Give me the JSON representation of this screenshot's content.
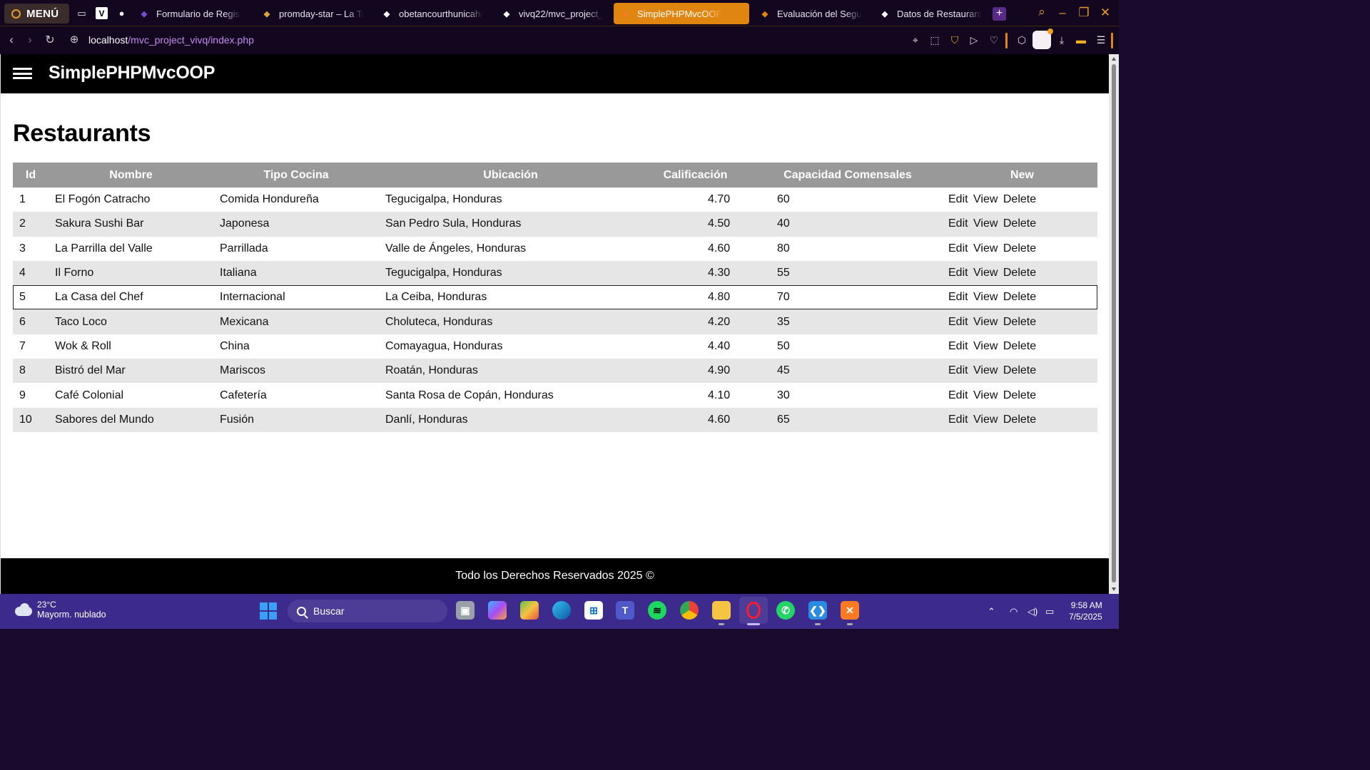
{
  "browser": {
    "menu_label": "MENÚ",
    "tabs": [
      {
        "label": "Formulario de Registro",
        "icon": "form-icon",
        "color": "#7a4bd1"
      },
      {
        "label": "promday-star – La Tarea",
        "icon": "page-icon",
        "color": "#d9a441"
      },
      {
        "label": "obetancourthunicah/",
        "icon": "github-icon",
        "color": "#ffffff"
      },
      {
        "label": "vivq22/mvc_project_",
        "icon": "github-icon",
        "color": "#ffffff"
      },
      {
        "label": "SimplePHPMvcOOP",
        "icon": "xampp-icon",
        "color": "#fb7a24"
      },
      {
        "label": "Evaluación del Seguimiento",
        "icon": "in-icon",
        "color": "#e08510"
      },
      {
        "label": "Datos de Restaurantes",
        "icon": "openai-icon",
        "color": "#ffffff"
      }
    ],
    "active_tab_index": 4,
    "url_host": "localhost",
    "url_path": "/mvc_project_vivq/index.php"
  },
  "site": {
    "title": "SimplePHPMvcOOP",
    "footer": "Todo los Derechos Reservados 2025 ©"
  },
  "page": {
    "heading": "Restaurants",
    "columns": {
      "id": "Id",
      "nombre": "Nombre",
      "tipo": "Tipo Cocina",
      "ubicacion": "Ubicación",
      "calificacion": "Calificación",
      "capacidad": "Capacidad Comensales",
      "new": "New"
    },
    "actions": {
      "edit": "Edit",
      "view": "View",
      "delete": "Delete"
    },
    "rows": [
      {
        "id": "1",
        "nombre": "El Fogón Catracho",
        "tipo": "Comida Hondureña",
        "ubicacion": "Tegucigalpa, Honduras",
        "calificacion": "4.70",
        "capacidad": "60"
      },
      {
        "id": "2",
        "nombre": "Sakura Sushi Bar",
        "tipo": "Japonesa",
        "ubicacion": "San Pedro Sula, Honduras",
        "calificacion": "4.50",
        "capacidad": "40"
      },
      {
        "id": "3",
        "nombre": "La Parrilla del Valle",
        "tipo": "Parrillada",
        "ubicacion": "Valle de Ángeles, Honduras",
        "calificacion": "4.60",
        "capacidad": "80"
      },
      {
        "id": "4",
        "nombre": "Il Forno",
        "tipo": "Italiana",
        "ubicacion": "Tegucigalpa, Honduras",
        "calificacion": "4.30",
        "capacidad": "55"
      },
      {
        "id": "5",
        "nombre": "La Casa del Chef",
        "tipo": "Internacional",
        "ubicacion": "La Ceiba, Honduras",
        "calificacion": "4.80",
        "capacidad": "70"
      },
      {
        "id": "6",
        "nombre": "Taco Loco",
        "tipo": "Mexicana",
        "ubicacion": "Choluteca, Honduras",
        "calificacion": "4.20",
        "capacidad": "35"
      },
      {
        "id": "7",
        "nombre": "Wok & Roll",
        "tipo": "China",
        "ubicacion": "Comayagua, Honduras",
        "calificacion": "4.40",
        "capacidad": "50"
      },
      {
        "id": "8",
        "nombre": "Bistró del Mar",
        "tipo": "Mariscos",
        "ubicacion": "Roatán, Honduras",
        "calificacion": "4.90",
        "capacidad": "45"
      },
      {
        "id": "9",
        "nombre": "Café Colonial",
        "tipo": "Cafetería",
        "ubicacion": "Santa Rosa de Copán, Honduras",
        "calificacion": "4.10",
        "capacidad": "30"
      },
      {
        "id": "10",
        "nombre": "Sabores del Mundo",
        "tipo": "Fusión",
        "ubicacion": "Danlí, Honduras",
        "calificacion": "4.60",
        "capacidad": "65"
      }
    ],
    "highlighted_row_index": 4
  },
  "taskbar": {
    "temperature": "23°C",
    "weather": "Mayorm. nublado",
    "search_placeholder": "Buscar",
    "time": "9:58 AM",
    "date": "7/5/2025"
  }
}
